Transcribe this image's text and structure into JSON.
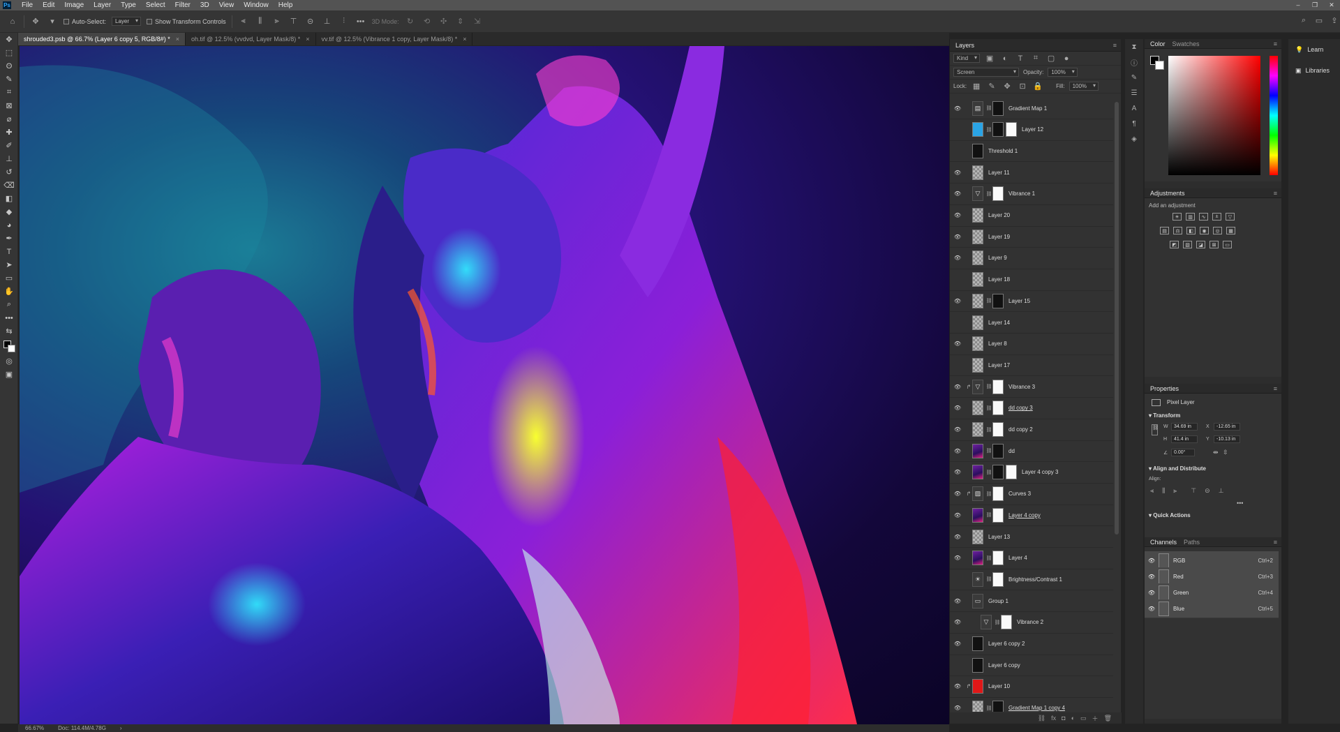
{
  "app": {
    "logo": "Ps"
  },
  "menu": [
    "File",
    "Edit",
    "Image",
    "Layer",
    "Type",
    "Select",
    "Filter",
    "3D",
    "View",
    "Window",
    "Help"
  ],
  "window_controls": [
    "–",
    "❐",
    "✕"
  ],
  "options": {
    "auto_select_label": "Auto-Select:",
    "auto_select_value": "Layer",
    "show_transform_label": "Show Transform Controls",
    "mode_3d_label": "3D Mode:"
  },
  "tabs": [
    {
      "label": "shrouded3.psb @ 66.7% (Layer 6 copy 5, RGB/8#) *",
      "active": true
    },
    {
      "label": "oh.tif @ 12.5% (vvdvd, Layer Mask/8) *",
      "active": false
    },
    {
      "label": "vv.tif @ 12.5% (Vibrance 1 copy, Layer Mask/8) *",
      "active": false
    }
  ],
  "status": {
    "zoom": "66.67%",
    "doc": "Doc: 114.4M/4.78G"
  },
  "layers_panel": {
    "title": "Layers",
    "filter_label": "Kind",
    "blend_mode": "Screen",
    "opacity_label": "Opacity:",
    "opacity_value": "100%",
    "lock_label": "Lock:",
    "fill_label": "Fill:",
    "fill_value": "100%",
    "layers": [
      {
        "name": "Gradient Map 1",
        "visible": true,
        "thumb": "adj",
        "glyph": "▤",
        "mask": "black"
      },
      {
        "name": "Layer 12",
        "visible": false,
        "thumb": "blue",
        "mask": "black",
        "mask2": "white"
      },
      {
        "name": "Threshold 1",
        "visible": false,
        "thumb": "black"
      },
      {
        "name": "Layer 11",
        "visible": true,
        "thumb": "check"
      },
      {
        "name": "Vibrance 1",
        "visible": true,
        "thumb": "adj",
        "glyph": "▽",
        "mask": "white"
      },
      {
        "name": "Layer 20",
        "visible": true,
        "thumb": "check"
      },
      {
        "name": "Layer 19",
        "visible": true,
        "thumb": "check"
      },
      {
        "name": "Layer 9",
        "visible": true,
        "thumb": "check"
      },
      {
        "name": "Layer 18",
        "visible": false,
        "thumb": "check"
      },
      {
        "name": "Layer 15",
        "visible": true,
        "thumb": "check",
        "mask": "black"
      },
      {
        "name": "Layer 14",
        "visible": false,
        "thumb": "check"
      },
      {
        "name": "Layer 8",
        "visible": true,
        "thumb": "check"
      },
      {
        "name": "Layer 17",
        "visible": false,
        "thumb": "check"
      },
      {
        "name": "Vibrance 3",
        "visible": true,
        "thumb": "adj",
        "glyph": "▽",
        "mask": "white",
        "clip": true
      },
      {
        "name": "dd copy 3",
        "visible": true,
        "thumb": "check",
        "mask": "white",
        "underline": true
      },
      {
        "name": "dd copy 2",
        "visible": true,
        "thumb": "check",
        "mask": "white"
      },
      {
        "name": "dd",
        "visible": true,
        "thumb": "art",
        "mask": "black"
      },
      {
        "name": "Layer 4 copy 3",
        "visible": true,
        "thumb": "art",
        "mask": "black",
        "mask2": "white"
      },
      {
        "name": "Curves 3",
        "visible": true,
        "thumb": "adj",
        "glyph": "▨",
        "mask": "white",
        "clip": true
      },
      {
        "name": "Layer 4 copy",
        "visible": true,
        "thumb": "art",
        "mask": "white",
        "underline": true
      },
      {
        "name": "Layer 13",
        "visible": true,
        "thumb": "check"
      },
      {
        "name": "Layer 4",
        "visible": true,
        "thumb": "art",
        "mask": "white"
      },
      {
        "name": "Brightness/Contrast 1",
        "visible": false,
        "thumb": "adj",
        "glyph": "☀",
        "mask": "white"
      },
      {
        "name": "Group 1",
        "visible": true,
        "thumb": "folder"
      },
      {
        "name": "Vibrance 2",
        "visible": true,
        "thumb": "adj",
        "glyph": "▽",
        "mask": "white",
        "indent": true
      },
      {
        "name": "Layer 6 copy 2",
        "visible": true,
        "thumb": "black"
      },
      {
        "name": "Layer 6 copy",
        "visible": false,
        "thumb": "black"
      },
      {
        "name": "Layer 10",
        "visible": true,
        "thumb": "red",
        "clip": true
      },
      {
        "name": "Gradient Map 1 copy 4",
        "visible": true,
        "thumb": "check",
        "mask": "black",
        "underline": true
      }
    ],
    "footer_icons": [
      "⛓",
      "fx",
      "◘",
      "◐",
      "▭",
      "＋",
      "🗑"
    ]
  },
  "color_panel": {
    "tab1": "Color",
    "tab2": "Swatches"
  },
  "adjustments_panel": {
    "title": "Adjustments",
    "subtitle": "Add an adjustment"
  },
  "properties_panel": {
    "title": "Properties",
    "type": "Pixel Layer",
    "transform_title": "Transform",
    "w_label": "W",
    "w_value": "34.69 in",
    "x_label": "X",
    "x_value": "-12.65 in",
    "h_label": "H",
    "h_value": "41.4 in",
    "y_label": "Y",
    "y_value": "-10.13 in",
    "angle_value": "0.00°",
    "align_title": "Align and Distribute",
    "align_label": "Align:",
    "quick_actions_title": "Quick Actions"
  },
  "channels_panel": {
    "tab1": "Channels",
    "tab2": "Paths",
    "channels": [
      {
        "name": "RGB",
        "shortcut": "Ctrl+2"
      },
      {
        "name": "Red",
        "shortcut": "Ctrl+3"
      },
      {
        "name": "Green",
        "shortcut": "Ctrl+4"
      },
      {
        "name": "Blue",
        "shortcut": "Ctrl+5"
      }
    ]
  },
  "learn_column": {
    "learn": "Learn",
    "libraries": "Libraries"
  }
}
